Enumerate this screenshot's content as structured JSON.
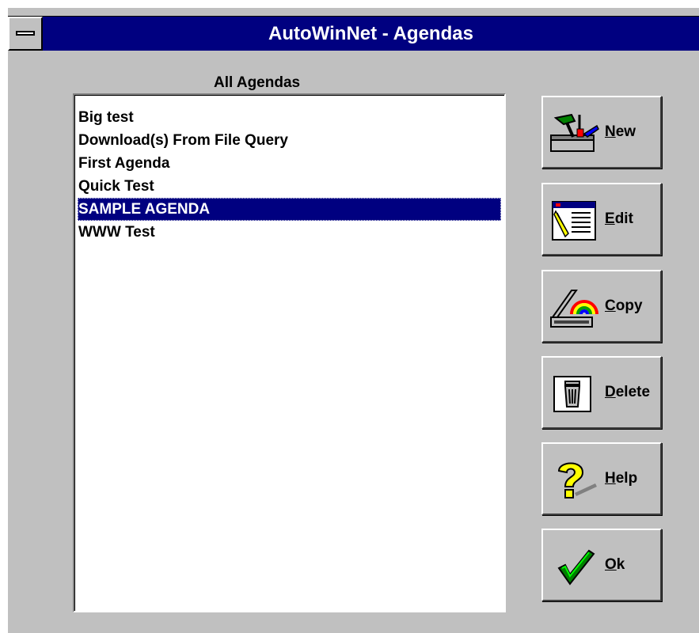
{
  "window": {
    "title": "AutoWinNet - Agendas"
  },
  "list": {
    "heading": "All Agendas",
    "items": [
      "Big test",
      "Download(s) From File Query",
      "First Agenda",
      "Quick Test",
      "SAMPLE AGENDA",
      "WWW Test"
    ],
    "selected": "SAMPLE AGENDA"
  },
  "buttons": {
    "new": {
      "label": "New",
      "mnemonic": "N",
      "icon": "toolbox-icon"
    },
    "edit": {
      "label": "Edit",
      "mnemonic": "E",
      "icon": "notepad-icon"
    },
    "copy": {
      "label": "Copy",
      "mnemonic": "C",
      "icon": "copier-rainbow-icon"
    },
    "delete": {
      "label": "Delete",
      "mnemonic": "D",
      "icon": "trash-can-icon"
    },
    "help": {
      "label": "Help",
      "mnemonic": "H",
      "icon": "question-mark-icon"
    },
    "ok": {
      "label": "Ok",
      "mnemonic": "O",
      "icon": "checkmark-icon"
    }
  },
  "colors": {
    "titlebar": "#000080",
    "face": "#c0c0c0",
    "selection": "#000080"
  }
}
